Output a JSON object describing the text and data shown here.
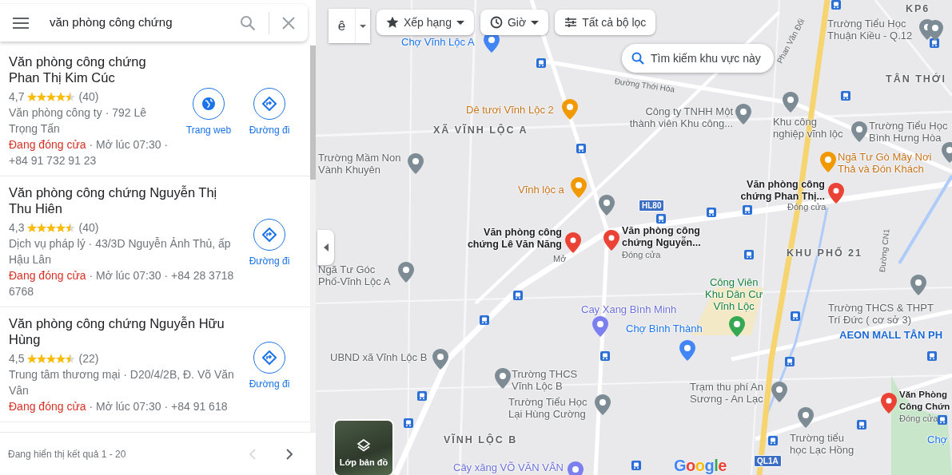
{
  "search": {
    "value": "văn phòng công chứng"
  },
  "results": [
    {
      "name": "Văn phòng công chứng Phan Thị Kim Cúc",
      "rating": "4,7",
      "stars": 4.5,
      "reviews": "(40)",
      "details": "Văn phòng công ty · 792 Lê Trọng Tấn",
      "status": "Đang đóng cửa",
      "hours": "· Mở lúc 07:30 · +84 91 732 91 23",
      "actions": [
        {
          "kind": "website",
          "label": "Trang web"
        },
        {
          "kind": "directions",
          "label": "Đường đi"
        }
      ]
    },
    {
      "name": "Văn phòng công chứng Nguyễn Thị Thu Hiên",
      "rating": "4,3",
      "stars": 4.5,
      "reviews": "(40)",
      "details": "Dịch vụ pháp lý · 43/3D Nguyễn Ảnh Thủ, ấp Hậu Lân",
      "status": "Đang đóng cửa",
      "hours": "· Mở lúc 07:30 · +84 28 3718 6768",
      "actions": [
        {
          "kind": "directions",
          "label": "Đường đi"
        }
      ]
    },
    {
      "name": "Văn phòng công chứng Nguyễn Hữu Hùng",
      "rating": "4,5",
      "stars": 4.5,
      "reviews": "(22)",
      "details": "Trung tâm thương mại · D20/4/2B, Đ. Võ Văn Vân",
      "status": "Đang đóng cửa",
      "hours": "· Mở lúc 07:30 · +84 91 618",
      "actions": [
        {
          "kind": "directions",
          "label": "Đường đi"
        }
      ]
    }
  ],
  "pagination": {
    "summary": "Đang hiển thị kết quả 1 - 20",
    "prev": {
      "disabled": true
    },
    "next": {
      "disabled": false
    }
  },
  "filters": [
    {
      "kind": "split",
      "label": "ê"
    },
    {
      "kind": "rating",
      "label": "Xếp hạng"
    },
    {
      "kind": "hours",
      "label": "Giờ"
    },
    {
      "kind": "all",
      "label": "Tất cả bộ lọc"
    }
  ],
  "search_area_button": "Tìm kiếm khu vực này",
  "layers_button": "Lớp bản đồ",
  "map_labels": [
    {
      "kind": "area",
      "text": "KP6"
    },
    {
      "kind": "school",
      "text": "Trường Tiểu Học\nThuận Kiều - Q.12"
    },
    {
      "kind": "market",
      "text": "Chợ Vĩnh Lộc A"
    },
    {
      "kind": "area",
      "text": "TÂN THỚI"
    },
    {
      "kind": "food",
      "text": "Dê tươi Vĩnh Lộc 2"
    },
    {
      "kind": "area",
      "text": "XÃ VĨNH LỘC A"
    },
    {
      "kind": "place",
      "text": "Công ty TNHH Một\nthành viên Khu công..."
    },
    {
      "kind": "place",
      "text": "Khu công\nnghiệp vĩnh lộc"
    },
    {
      "kind": "school",
      "text": "Trường Tiểu Học\nBình Hưng Hòa"
    },
    {
      "kind": "school",
      "text": "Trường Mầm Non\nVành Khuyên"
    },
    {
      "kind": "cafe",
      "text": "Ngã Tư Gò Mây Nơi\nThả và Đón Khách"
    },
    {
      "kind": "food",
      "text": "Vĩnh lộc a"
    },
    {
      "kind": "result",
      "text": "Văn phòng công\nchứng Phan Thị...",
      "status": "Đóng cửa"
    },
    {
      "kind": "result",
      "text": "Văn phòng công\nchứng Lê Văn Năng",
      "status": "Mở"
    },
    {
      "kind": "result",
      "text": "Văn phòng công\nchứng Nguyễn...",
      "status": "Đóng cửa"
    },
    {
      "kind": "area",
      "text": "KHU PHỐ 21"
    },
    {
      "kind": "place",
      "text": "Ngã Tư Góc\nPhố-Vĩnh Lộc A"
    },
    {
      "kind": "gas",
      "text": "Cay Xang Bình Minh"
    },
    {
      "kind": "park",
      "text": "Công Viên\nKhu Dân Cư\nVĩnh Lộc"
    },
    {
      "kind": "market",
      "text": "Chợ Bình Thành"
    },
    {
      "kind": "school",
      "text": "Trường THCS & THPT\nTrí Đức ( cơ sở 3)"
    },
    {
      "kind": "mall",
      "text": "AEON MALL TÂN PH"
    },
    {
      "kind": "government",
      "text": "UBND xã Vĩnh Lộc B"
    },
    {
      "kind": "school",
      "text": "Trường THCS\nVĩnh Lộc B"
    },
    {
      "kind": "place",
      "text": "Trạm thu phí An\nSương - An Lạc"
    },
    {
      "kind": "school",
      "text": "Trường Tiểu Học\nLại Hùng Cường"
    },
    {
      "kind": "result",
      "text": "Văn Phòng\nCông Chứn",
      "status": "Đóng cửa"
    },
    {
      "kind": "area",
      "text": "VĨNH LỘC B"
    },
    {
      "kind": "school",
      "text": "Trường tiểu\nhọc Lạc Hồng"
    },
    {
      "kind": "market",
      "text": "Chợ"
    },
    {
      "kind": "gas",
      "text": "Cây xăng VÕ VĂN VÂN"
    }
  ],
  "road_labels": [
    {
      "kind": "street",
      "text": "Phan Văn Đối"
    },
    {
      "kind": "street",
      "text": "Đường Thới Hòa"
    },
    {
      "kind": "shield",
      "text": "HL80"
    },
    {
      "kind": "street",
      "text": "Đường CN1"
    },
    {
      "kind": "shield",
      "text": "QL1A"
    }
  ],
  "logo": "Google"
}
